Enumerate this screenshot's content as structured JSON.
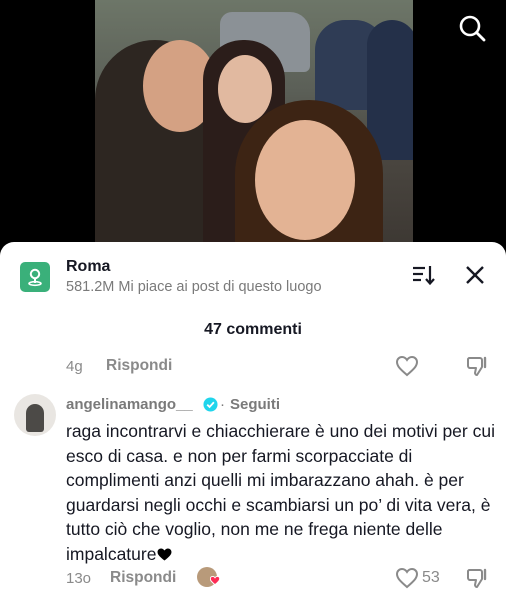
{
  "place": {
    "title": "Roma",
    "subtitle": "581.2M Mi piace ai post di questo luogo"
  },
  "comments_header": {
    "count_label": "47 commenti"
  },
  "previous_comment": {
    "time": "4g",
    "reply_label": "Rispondi"
  },
  "comment": {
    "username": "angelinamango__",
    "separator": "·",
    "follow_status": "Seguiti",
    "text": "raga incontrarvi e chiacchierare è uno dei motivi per cui esco di casa. e non per farmi scorpacciate di complimenti anzi quelli mi imbarazzano ahah. è per guardarsi negli occhi e scambiarsi un po’ di vita vera, è tutto ciò che voglio, non me ne frega niente delle impalcature",
    "time": "13o",
    "reply_label": "Rispondi",
    "likes": "53"
  },
  "icons": {
    "search": "search-icon",
    "place": "location-pin-icon",
    "sort": "sort-icon",
    "close": "close-icon",
    "heart": "heart-outline-icon",
    "dislike": "thumbs-down-icon",
    "verified": "verified-badge-icon"
  },
  "colors": {
    "place_icon_bg": "#3ab07a",
    "verified": "#20d5ec",
    "creator_heart": "#fe2c55"
  }
}
